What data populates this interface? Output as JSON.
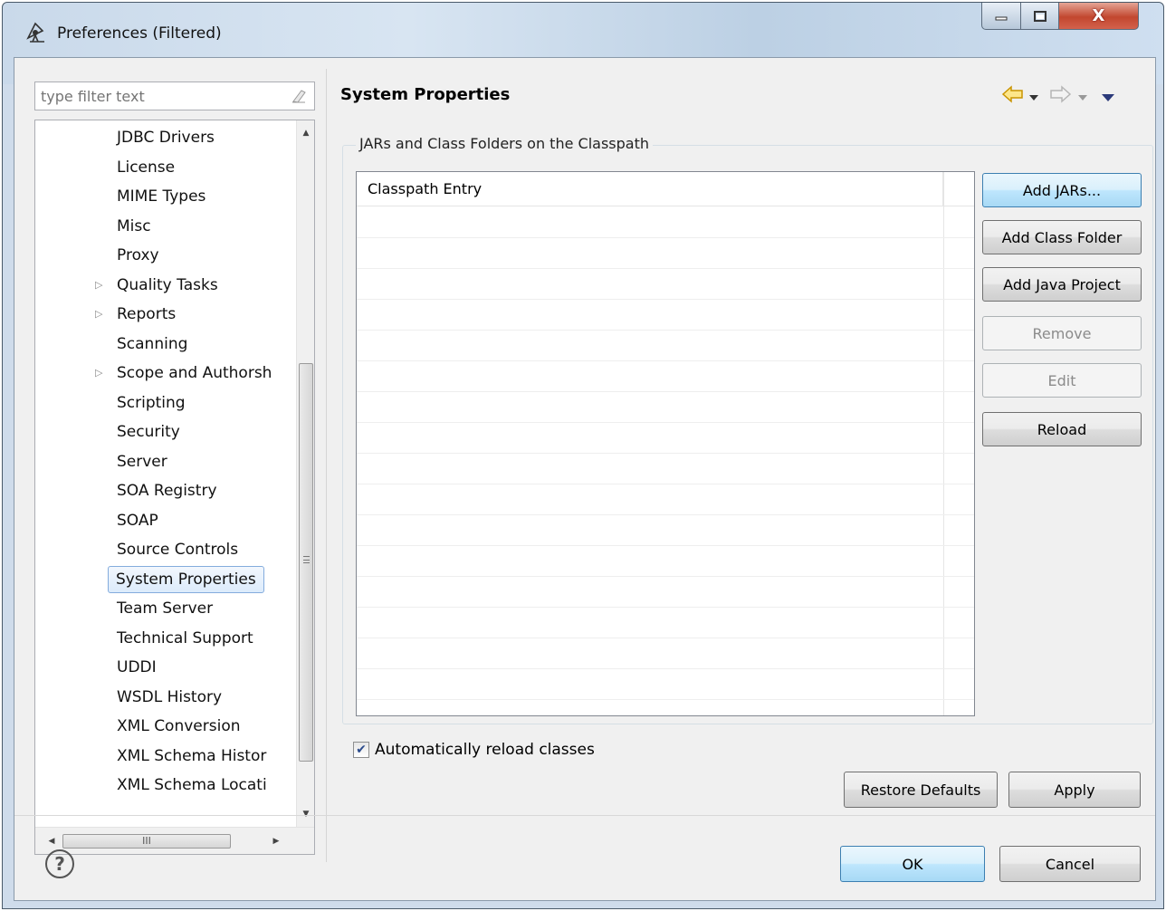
{
  "window": {
    "title": "Preferences (Filtered)",
    "close_glyph": "X"
  },
  "filter": {
    "placeholder": "type filter text"
  },
  "tree": {
    "items": [
      {
        "label": "JDBC Drivers",
        "expandable": false
      },
      {
        "label": "License",
        "expandable": false
      },
      {
        "label": "MIME Types",
        "expandable": false
      },
      {
        "label": "Misc",
        "expandable": false
      },
      {
        "label": "Proxy",
        "expandable": false
      },
      {
        "label": "Quality Tasks",
        "expandable": true
      },
      {
        "label": "Reports",
        "expandable": true
      },
      {
        "label": "Scanning",
        "expandable": false
      },
      {
        "label": "Scope and Authorsh",
        "expandable": true
      },
      {
        "label": "Scripting",
        "expandable": false
      },
      {
        "label": "Security",
        "expandable": false
      },
      {
        "label": "Server",
        "expandable": false
      },
      {
        "label": "SOA Registry",
        "expandable": false
      },
      {
        "label": "SOAP",
        "expandable": false
      },
      {
        "label": "Source Controls",
        "expandable": false
      },
      {
        "label": "System Properties",
        "expandable": false,
        "selected": true
      },
      {
        "label": "Team Server",
        "expandable": false
      },
      {
        "label": "Technical Support",
        "expandable": false
      },
      {
        "label": "UDDI",
        "expandable": false
      },
      {
        "label": "WSDL History",
        "expandable": false
      },
      {
        "label": "XML Conversion",
        "expandable": false
      },
      {
        "label": "XML Schema Histor",
        "expandable": false
      },
      {
        "label": "XML Schema Locati",
        "expandable": false
      }
    ],
    "hscroll_thumb": "III"
  },
  "page": {
    "title": "System Properties",
    "group_label": "JARs and Class Folders on the Classpath",
    "table": {
      "columns": [
        "Classpath Entry"
      ],
      "rows": []
    },
    "buttons": {
      "add_jars": "Add JARs...",
      "add_class_folder": "Add Class Folder",
      "add_java_project": "Add Java Project",
      "remove": "Remove",
      "edit": "Edit",
      "reload": "Reload"
    },
    "auto_reload": {
      "label": "Automatically reload classes",
      "checked": true
    },
    "restore_defaults": "Restore Defaults",
    "apply": "Apply"
  },
  "footer": {
    "help_glyph": "?",
    "ok": "OK",
    "cancel": "Cancel"
  },
  "colors": {
    "accent_button": "#bee6fd",
    "nav_back": "#e8b400",
    "nav_menu": "#2b3a7a"
  }
}
